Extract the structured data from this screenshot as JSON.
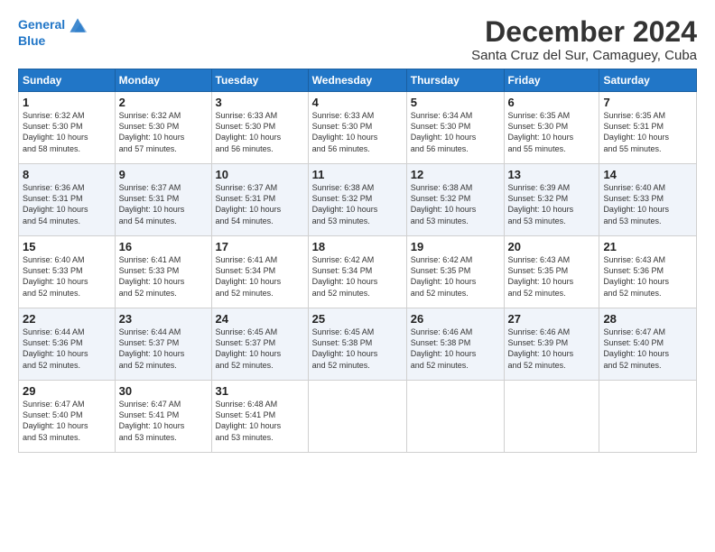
{
  "logo": {
    "line1": "General",
    "line2": "Blue"
  },
  "title": "December 2024",
  "subtitle": "Santa Cruz del Sur, Camaguey, Cuba",
  "weekdays": [
    "Sunday",
    "Monday",
    "Tuesday",
    "Wednesday",
    "Thursday",
    "Friday",
    "Saturday"
  ],
  "weeks": [
    [
      {
        "day": "1",
        "info": "Sunrise: 6:32 AM\nSunset: 5:30 PM\nDaylight: 10 hours\nand 58 minutes."
      },
      {
        "day": "2",
        "info": "Sunrise: 6:32 AM\nSunset: 5:30 PM\nDaylight: 10 hours\nand 57 minutes."
      },
      {
        "day": "3",
        "info": "Sunrise: 6:33 AM\nSunset: 5:30 PM\nDaylight: 10 hours\nand 56 minutes."
      },
      {
        "day": "4",
        "info": "Sunrise: 6:33 AM\nSunset: 5:30 PM\nDaylight: 10 hours\nand 56 minutes."
      },
      {
        "day": "5",
        "info": "Sunrise: 6:34 AM\nSunset: 5:30 PM\nDaylight: 10 hours\nand 56 minutes."
      },
      {
        "day": "6",
        "info": "Sunrise: 6:35 AM\nSunset: 5:30 PM\nDaylight: 10 hours\nand 55 minutes."
      },
      {
        "day": "7",
        "info": "Sunrise: 6:35 AM\nSunset: 5:31 PM\nDaylight: 10 hours\nand 55 minutes."
      }
    ],
    [
      {
        "day": "8",
        "info": "Sunrise: 6:36 AM\nSunset: 5:31 PM\nDaylight: 10 hours\nand 54 minutes."
      },
      {
        "day": "9",
        "info": "Sunrise: 6:37 AM\nSunset: 5:31 PM\nDaylight: 10 hours\nand 54 minutes."
      },
      {
        "day": "10",
        "info": "Sunrise: 6:37 AM\nSunset: 5:31 PM\nDaylight: 10 hours\nand 54 minutes."
      },
      {
        "day": "11",
        "info": "Sunrise: 6:38 AM\nSunset: 5:32 PM\nDaylight: 10 hours\nand 53 minutes."
      },
      {
        "day": "12",
        "info": "Sunrise: 6:38 AM\nSunset: 5:32 PM\nDaylight: 10 hours\nand 53 minutes."
      },
      {
        "day": "13",
        "info": "Sunrise: 6:39 AM\nSunset: 5:32 PM\nDaylight: 10 hours\nand 53 minutes."
      },
      {
        "day": "14",
        "info": "Sunrise: 6:40 AM\nSunset: 5:33 PM\nDaylight: 10 hours\nand 53 minutes."
      }
    ],
    [
      {
        "day": "15",
        "info": "Sunrise: 6:40 AM\nSunset: 5:33 PM\nDaylight: 10 hours\nand 52 minutes."
      },
      {
        "day": "16",
        "info": "Sunrise: 6:41 AM\nSunset: 5:33 PM\nDaylight: 10 hours\nand 52 minutes."
      },
      {
        "day": "17",
        "info": "Sunrise: 6:41 AM\nSunset: 5:34 PM\nDaylight: 10 hours\nand 52 minutes."
      },
      {
        "day": "18",
        "info": "Sunrise: 6:42 AM\nSunset: 5:34 PM\nDaylight: 10 hours\nand 52 minutes."
      },
      {
        "day": "19",
        "info": "Sunrise: 6:42 AM\nSunset: 5:35 PM\nDaylight: 10 hours\nand 52 minutes."
      },
      {
        "day": "20",
        "info": "Sunrise: 6:43 AM\nSunset: 5:35 PM\nDaylight: 10 hours\nand 52 minutes."
      },
      {
        "day": "21",
        "info": "Sunrise: 6:43 AM\nSunset: 5:36 PM\nDaylight: 10 hours\nand 52 minutes."
      }
    ],
    [
      {
        "day": "22",
        "info": "Sunrise: 6:44 AM\nSunset: 5:36 PM\nDaylight: 10 hours\nand 52 minutes."
      },
      {
        "day": "23",
        "info": "Sunrise: 6:44 AM\nSunset: 5:37 PM\nDaylight: 10 hours\nand 52 minutes."
      },
      {
        "day": "24",
        "info": "Sunrise: 6:45 AM\nSunset: 5:37 PM\nDaylight: 10 hours\nand 52 minutes."
      },
      {
        "day": "25",
        "info": "Sunrise: 6:45 AM\nSunset: 5:38 PM\nDaylight: 10 hours\nand 52 minutes."
      },
      {
        "day": "26",
        "info": "Sunrise: 6:46 AM\nSunset: 5:38 PM\nDaylight: 10 hours\nand 52 minutes."
      },
      {
        "day": "27",
        "info": "Sunrise: 6:46 AM\nSunset: 5:39 PM\nDaylight: 10 hours\nand 52 minutes."
      },
      {
        "day": "28",
        "info": "Sunrise: 6:47 AM\nSunset: 5:40 PM\nDaylight: 10 hours\nand 52 minutes."
      }
    ],
    [
      {
        "day": "29",
        "info": "Sunrise: 6:47 AM\nSunset: 5:40 PM\nDaylight: 10 hours\nand 53 minutes."
      },
      {
        "day": "30",
        "info": "Sunrise: 6:47 AM\nSunset: 5:41 PM\nDaylight: 10 hours\nand 53 minutes."
      },
      {
        "day": "31",
        "info": "Sunrise: 6:48 AM\nSunset: 5:41 PM\nDaylight: 10 hours\nand 53 minutes."
      },
      null,
      null,
      null,
      null
    ]
  ]
}
